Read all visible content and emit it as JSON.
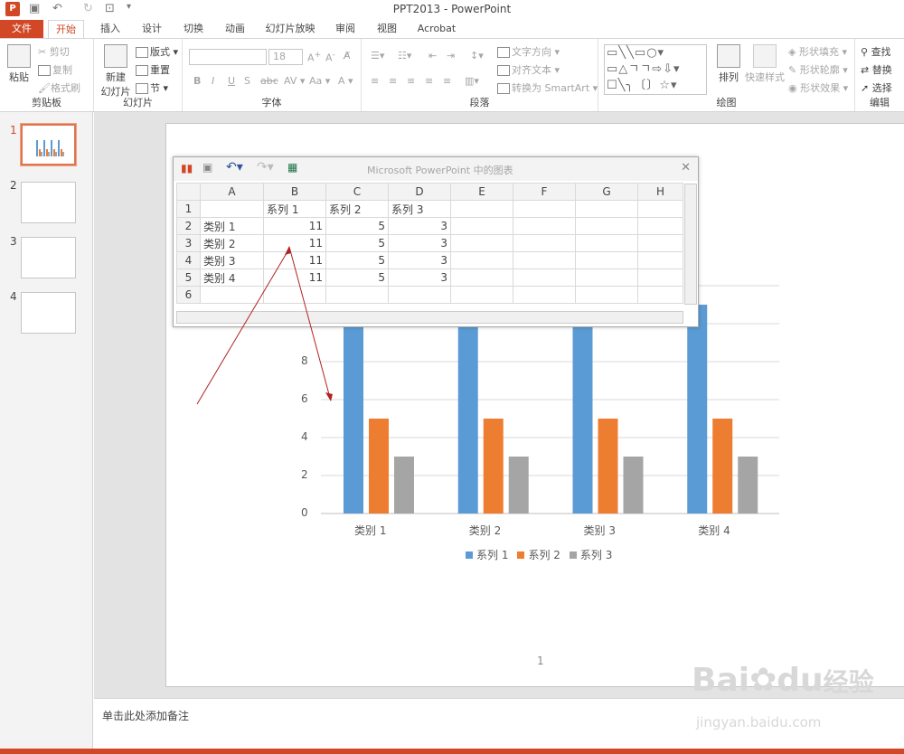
{
  "titlebar": {
    "title": "PPT2013 - PowerPoint",
    "app_icon": "P"
  },
  "tabs": [
    {
      "label": "文件"
    },
    {
      "label": "开始"
    },
    {
      "label": "插入"
    },
    {
      "label": "设计"
    },
    {
      "label": "切换"
    },
    {
      "label": "动画"
    },
    {
      "label": "幻灯片放映"
    },
    {
      "label": "审阅"
    },
    {
      "label": "视图"
    },
    {
      "label": "Acrobat"
    }
  ],
  "ribbon": {
    "clipboard": {
      "label": "剪贴板",
      "paste": "粘贴",
      "cut": "剪切",
      "copy": "复制",
      "format_painter": "格式刷"
    },
    "slides": {
      "label": "幻灯片",
      "new_slide_1": "新建",
      "new_slide_2": "幻灯片",
      "layout": "版式",
      "reset": "重置",
      "section": "节"
    },
    "font": {
      "label": "字体",
      "size": "18"
    },
    "paragraph": {
      "label": "段落",
      "text_direction": "文字方向",
      "align_text": "对齐文本",
      "convert_smartart": "转换为 SmartArt"
    },
    "drawing": {
      "label": "绘图",
      "arrange": "排列",
      "quick_styles": "快速样式",
      "shape_fill": "形状填充",
      "shape_outline": "形状轮廓",
      "shape_effects": "形状效果"
    },
    "editing": {
      "label": "编辑",
      "find": "查找",
      "replace": "替换",
      "select": "选择"
    }
  },
  "slides": [
    {
      "num": "1"
    },
    {
      "num": "2"
    },
    {
      "num": "3"
    },
    {
      "num": "4"
    }
  ],
  "notes_placeholder": "单击此处添加备注",
  "slide_number": "1",
  "datasheet": {
    "title": "Microsoft PowerPoint 中的图表",
    "columns": [
      "A",
      "B",
      "C",
      "D",
      "E",
      "F",
      "G",
      "H"
    ],
    "rows": [
      {
        "num": "1",
        "cells": [
          "",
          "系列 1",
          "系列 2",
          "系列 3",
          "",
          "",
          "",
          ""
        ]
      },
      {
        "num": "2",
        "cells": [
          "类别 1",
          "11",
          "5",
          "3",
          "",
          "",
          "",
          ""
        ]
      },
      {
        "num": "3",
        "cells": [
          "类别 2",
          "11",
          "5",
          "3",
          "",
          "",
          "",
          ""
        ]
      },
      {
        "num": "4",
        "cells": [
          "类别 3",
          "11",
          "5",
          "3",
          "",
          "",
          "",
          ""
        ]
      },
      {
        "num": "5",
        "cells": [
          "类别 4",
          "11",
          "5",
          "3",
          "",
          "",
          "",
          ""
        ]
      },
      {
        "num": "6",
        "cells": [
          "",
          "",
          "",
          "",
          "",
          "",
          "",
          ""
        ]
      }
    ]
  },
  "chart_data": {
    "type": "bar",
    "categories": [
      "类别 1",
      "类别 2",
      "类别 3",
      "类别 4"
    ],
    "series": [
      {
        "name": "系列 1",
        "values": [
          11,
          11,
          11,
          11
        ],
        "color": "#5b9bd5"
      },
      {
        "name": "系列 2",
        "values": [
          5,
          5,
          5,
          5
        ],
        "color": "#ed7d31"
      },
      {
        "name": "系列 3",
        "values": [
          3,
          3,
          3,
          3
        ],
        "color": "#a5a5a5"
      }
    ],
    "y_ticks": [
      0,
      2,
      4,
      6,
      8
    ],
    "ylim": [
      0,
      12
    ],
    "grid": true,
    "legend": "bottom"
  },
  "watermark": {
    "text1": "Bai",
    "text2": "du",
    "text3": "经验",
    "url": "jingyan.baidu.com"
  }
}
